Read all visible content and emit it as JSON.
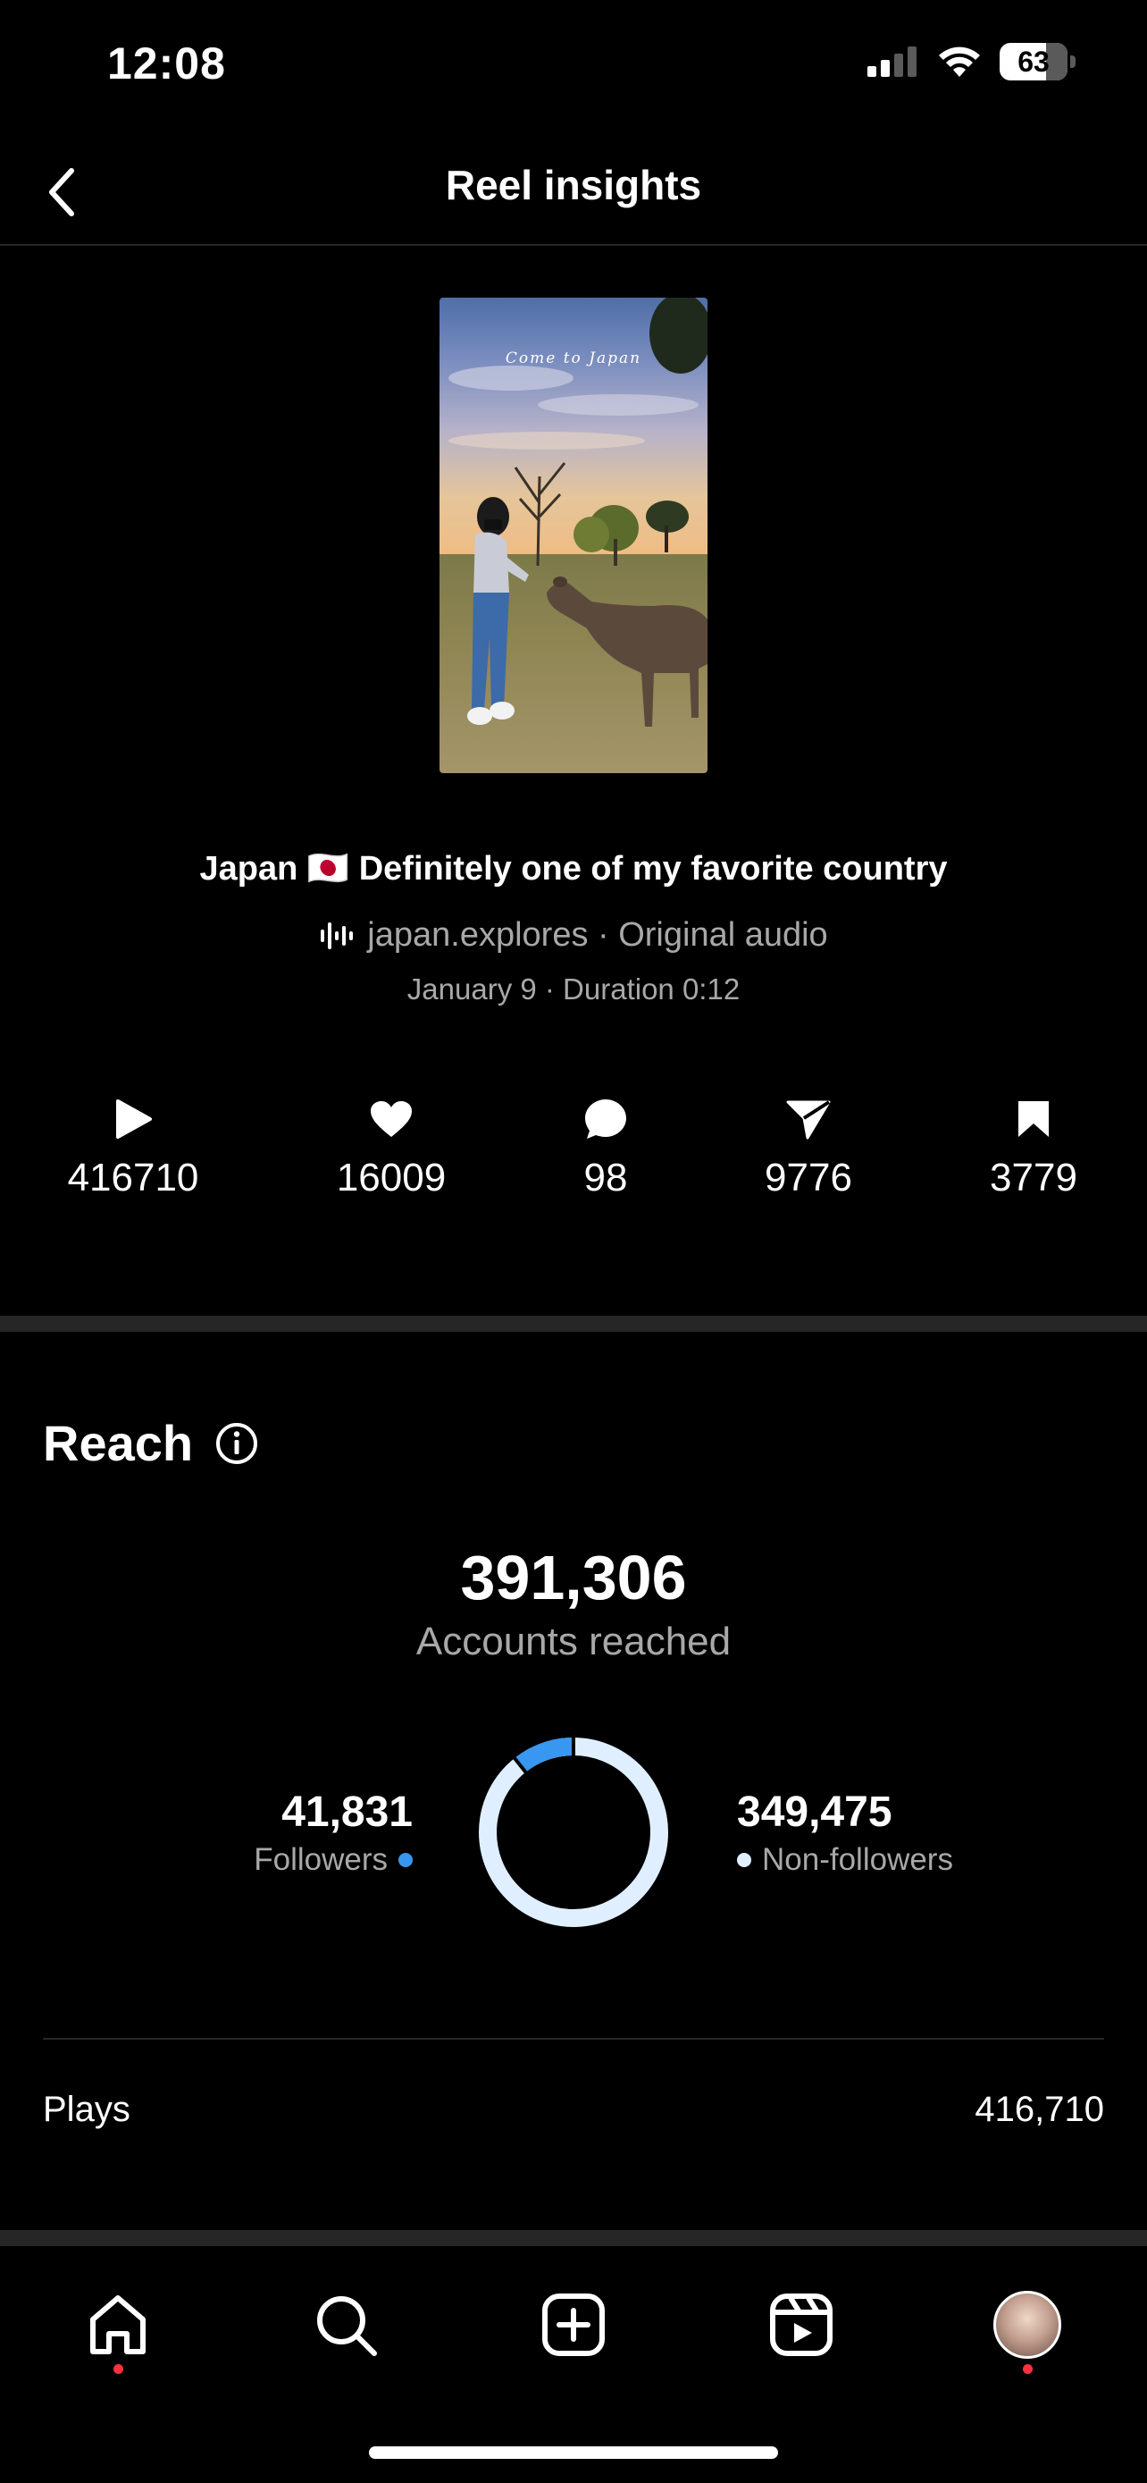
{
  "status_bar": {
    "time": "12:08",
    "battery": "63"
  },
  "header": {
    "title": "Reel insights"
  },
  "reel": {
    "thumbnail_caption": "Come to Japan",
    "title": "Japan 🇯🇵 Definitely one of my favorite country",
    "audio": "japan.explores · Original audio",
    "meta": "January 9 · Duration 0:12"
  },
  "stats": {
    "plays": "416710",
    "likes": "16009",
    "comments": "98",
    "shares": "9776",
    "saves": "3779"
  },
  "reach": {
    "title": "Reach",
    "accounts_reached": "391,306",
    "accounts_reached_label": "Accounts reached",
    "followers_value": "41,831",
    "followers_label": "Followers",
    "non_followers_value": "349,475",
    "non_followers_label": "Non-followers",
    "followers_share": 0.107,
    "colors": {
      "followers": "#3897f0",
      "non_followers": "#e0efff"
    }
  },
  "plays_row": {
    "label": "Plays",
    "value": "416,710"
  },
  "tab_bar": {
    "items": [
      "home-icon",
      "search-icon",
      "create-icon",
      "reels-icon",
      "profile-avatar"
    ],
    "notification_color": "#ff3040"
  }
}
